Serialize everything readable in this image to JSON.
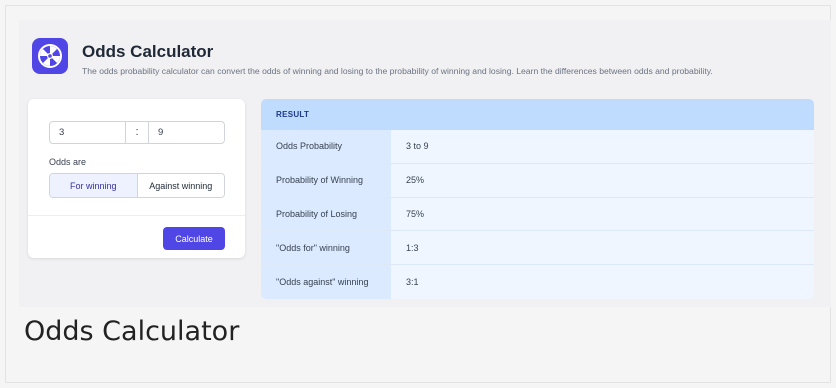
{
  "app": {
    "title": "Odds Calculator",
    "description": "The odds probability calculator can convert the odds of winning and losing to the probability of winning and losing. Learn the differences between odds and probability.",
    "logo_icon": "wheel-icon",
    "accent_color": "#4f46e5"
  },
  "form": {
    "odds_left": "3",
    "odds_separator": ":",
    "odds_right": "9",
    "odds_are_label": "Odds are",
    "toggle_options": [
      "For winning",
      "Against winning"
    ],
    "selected_option": "For winning",
    "calculate_label": "Calculate"
  },
  "result": {
    "header": "RESULT",
    "rows": [
      {
        "label": "Odds Probability",
        "value": "3 to 9"
      },
      {
        "label": "Probability of Winning",
        "value": "25%"
      },
      {
        "label": "Probability of Losing",
        "value": "75%"
      },
      {
        "label": "\"Odds for\" winning",
        "value": "1:3"
      },
      {
        "label": "\"Odds against\" winning",
        "value": "3:1"
      }
    ]
  },
  "footer": {
    "title": "Odds Calculator"
  }
}
